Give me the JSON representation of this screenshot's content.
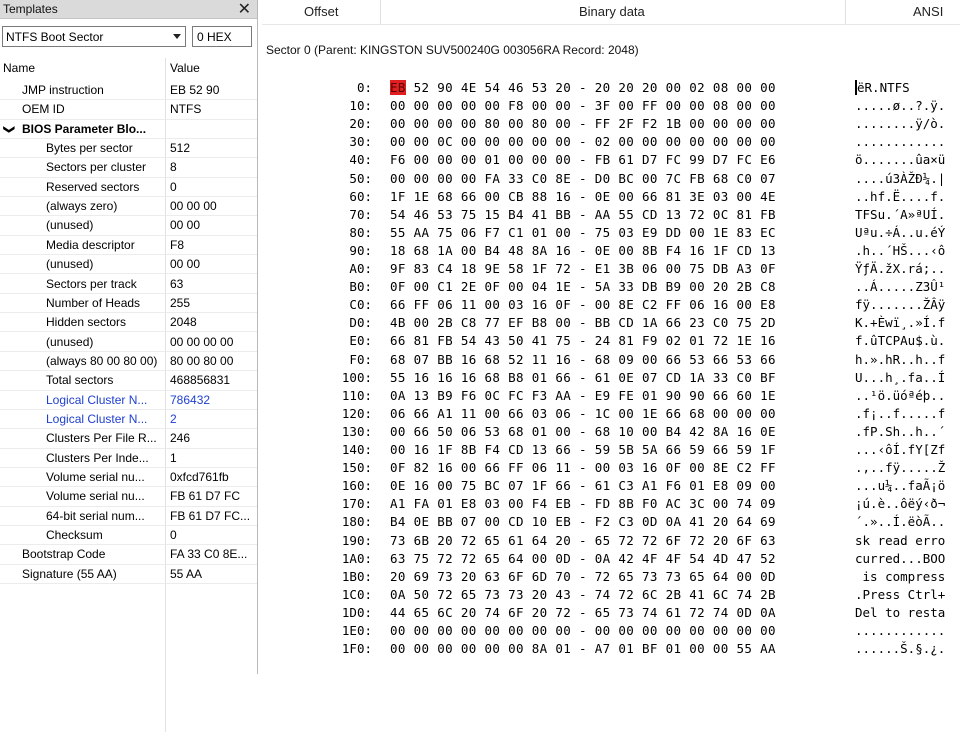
{
  "templates": {
    "title": "Templates",
    "template_select": "NTFS Boot Sector",
    "offset_field": "0 HEX",
    "columns": [
      "Name",
      "Value"
    ],
    "rows": [
      {
        "name": "JMP instruction",
        "value": "EB 52 90",
        "indent": 1
      },
      {
        "name": "OEM ID",
        "value": "NTFS",
        "indent": 1
      },
      {
        "name": "BIOS Parameter Blo...",
        "value": "",
        "indent": 0,
        "group": true
      },
      {
        "name": "Bytes per sector",
        "value": "512",
        "indent": 2
      },
      {
        "name": "Sectors per cluster",
        "value": "8",
        "indent": 2
      },
      {
        "name": "Reserved sectors",
        "value": "0",
        "indent": 2
      },
      {
        "name": "(always zero)",
        "value": "00 00 00",
        "indent": 2
      },
      {
        "name": "(unused)",
        "value": "00 00",
        "indent": 2
      },
      {
        "name": "Media descriptor",
        "value": "F8",
        "indent": 2
      },
      {
        "name": "(unused)",
        "value": "00 00",
        "indent": 2
      },
      {
        "name": "Sectors per track",
        "value": "63",
        "indent": 2
      },
      {
        "name": "Number of Heads",
        "value": "255",
        "indent": 2
      },
      {
        "name": "Hidden sectors",
        "value": "2048",
        "indent": 2
      },
      {
        "name": "(unused)",
        "value": "00 00 00 00",
        "indent": 2
      },
      {
        "name": "(always 80 00 80 00)",
        "value": "80 00 80 00",
        "indent": 2
      },
      {
        "name": "Total sectors",
        "value": "468856831",
        "indent": 2
      },
      {
        "name": "Logical Cluster N...",
        "value": "786432",
        "indent": 2,
        "link": true
      },
      {
        "name": "Logical Cluster N...",
        "value": "2",
        "indent": 2,
        "link": true
      },
      {
        "name": "Clusters Per File R...",
        "value": "246",
        "indent": 2
      },
      {
        "name": "Clusters Per Inde...",
        "value": "1",
        "indent": 2
      },
      {
        "name": "Volume serial nu...",
        "value": "0xfcd761fb",
        "indent": 2
      },
      {
        "name": "Volume serial nu...",
        "value": "FB 61 D7 FC",
        "indent": 2
      },
      {
        "name": "64-bit serial num...",
        "value": "FB 61 D7 FC...",
        "indent": 2
      },
      {
        "name": "Checksum",
        "value": "0",
        "indent": 2
      },
      {
        "name": "Bootstrap Code",
        "value": "FA 33 C0 8E...",
        "indent": 1
      },
      {
        "name": "Signature (55 AA)",
        "value": "55 AA",
        "indent": 1
      }
    ]
  },
  "hexview": {
    "headers": {
      "offset": "Offset",
      "binary": "Binary data",
      "ansi": "ANSI"
    },
    "sector_info": "Sector 0 (Parent: KINGSTON SUV500240G 003056RA Record: 2048)",
    "rows": [
      {
        "off": "0:",
        "hex": "EB 52 90 4E 54 46 53 20 - 20 20 20 00 02 08 00 00",
        "ansi": "ëR.NTFS"
      },
      {
        "off": "10:",
        "hex": "00 00 00 00 00 F8 00 00 - 3F 00 FF 00 00 08 00 00",
        "ansi": ".....ø..?.ÿ."
      },
      {
        "off": "20:",
        "hex": "00 00 00 00 80 00 80 00 - FF 2F F2 1B 00 00 00 00",
        "ansi": "........ÿ/ò."
      },
      {
        "off": "30:",
        "hex": "00 00 0C 00 00 00 00 00 - 02 00 00 00 00 00 00 00",
        "ansi": "............"
      },
      {
        "off": "40:",
        "hex": "F6 00 00 00 01 00 00 00 - FB 61 D7 FC 99 D7 FC E6",
        "ansi": "ö.......ûa×ü"
      },
      {
        "off": "50:",
        "hex": "00 00 00 00 FA 33 C0 8E - D0 BC 00 7C FB 68 C0 07",
        "ansi": "....ú3ÀŽÐ¼.|"
      },
      {
        "off": "60:",
        "hex": "1F 1E 68 66 00 CB 88 16 - 0E 00 66 81 3E 03 00 4E",
        "ansi": "..hf.Ë....f."
      },
      {
        "off": "70:",
        "hex": "54 46 53 75 15 B4 41 BB - AA 55 CD 13 72 0C 81 FB",
        "ansi": "TFSu.´A»ªUÍ."
      },
      {
        "off": "80:",
        "hex": "55 AA 75 06 F7 C1 01 00 - 75 03 E9 DD 00 1E 83 EC",
        "ansi": "Uªu.÷Á..u.éÝ"
      },
      {
        "off": "90:",
        "hex": "18 68 1A 00 B4 48 8A 16 - 0E 00 8B F4 16 1F CD 13",
        "ansi": ".h..´HŠ...‹ô"
      },
      {
        "off": "A0:",
        "hex": "9F 83 C4 18 9E 58 1F 72 - E1 3B 06 00 75 DB A3 0F",
        "ansi": "ŸƒÄ.žX.rá;.."
      },
      {
        "off": "B0:",
        "hex": "0F 00 C1 2E 0F 00 04 1E - 5A 33 DB B9 00 20 2B C8",
        "ansi": "..Á.....Z3Û¹"
      },
      {
        "off": "C0:",
        "hex": "66 FF 06 11 00 03 16 0F - 00 8E C2 FF 06 16 00 E8",
        "ansi": "fÿ.......ŽÂÿ"
      },
      {
        "off": "D0:",
        "hex": "4B 00 2B C8 77 EF B8 00 - BB CD 1A 66 23 C0 75 2D",
        "ansi": "K.+Èwï¸.»Í.f"
      },
      {
        "off": "E0:",
        "hex": "66 81 FB 54 43 50 41 75 - 24 81 F9 02 01 72 1E 16",
        "ansi": "f.ûTCPAu$.ù."
      },
      {
        "off": "F0:",
        "hex": "68 07 BB 16 68 52 11 16 - 68 09 00 66 53 66 53 66",
        "ansi": "h.».hR..h..f"
      },
      {
        "off": "100:",
        "hex": "55 16 16 16 68 B8 01 66 - 61 0E 07 CD 1A 33 C0 BF",
        "ansi": "U...h¸.fa..Í"
      },
      {
        "off": "110:",
        "hex": "0A 13 B9 F6 0C FC F3 AA - E9 FE 01 90 90 66 60 1E",
        "ansi": "..¹ö.üóªéþ.."
      },
      {
        "off": "120:",
        "hex": "06 66 A1 11 00 66 03 06 - 1C 00 1E 66 68 00 00 00",
        "ansi": ".f¡..f.....f"
      },
      {
        "off": "130:",
        "hex": "00 66 50 06 53 68 01 00 - 68 10 00 B4 42 8A 16 0E",
        "ansi": ".fP.Sh..h..´"
      },
      {
        "off": "140:",
        "hex": "00 16 1F 8B F4 CD 13 66 - 59 5B 5A 66 59 66 59 1F",
        "ansi": "...‹ôÍ.fY[Zf"
      },
      {
        "off": "150:",
        "hex": "0F 82 16 00 66 FF 06 11 - 00 03 16 0F 00 8E C2 FF",
        "ansi": ".‚..fÿ.....Ž"
      },
      {
        "off": "160:",
        "hex": "0E 16 00 75 BC 07 1F 66 - 61 C3 A1 F6 01 E8 09 00",
        "ansi": "...u¼..faÃ¡ö"
      },
      {
        "off": "170:",
        "hex": "A1 FA 01 E8 03 00 F4 EB - FD 8B F0 AC 3C 00 74 09",
        "ansi": "¡ú.è..ôëý‹ð¬"
      },
      {
        "off": "180:",
        "hex": "B4 0E BB 07 00 CD 10 EB - F2 C3 0D 0A 41 20 64 69",
        "ansi": "´.»..Í.ëòÃ.."
      },
      {
        "off": "190:",
        "hex": "73 6B 20 72 65 61 64 20 - 65 72 72 6F 72 20 6F 63",
        "ansi": "sk read erro"
      },
      {
        "off": "1A0:",
        "hex": "63 75 72 72 65 64 00 0D - 0A 42 4F 4F 54 4D 47 52",
        "ansi": "curred...BOO"
      },
      {
        "off": "1B0:",
        "hex": "20 69 73 20 63 6F 6D 70 - 72 65 73 73 65 64 00 0D",
        "ansi": " is compress"
      },
      {
        "off": "1C0:",
        "hex": "0A 50 72 65 73 73 20 43 - 74 72 6C 2B 41 6C 74 2B",
        "ansi": ".Press Ctrl+"
      },
      {
        "off": "1D0:",
        "hex": "44 65 6C 20 74 6F 20 72 - 65 73 74 61 72 74 0D 0A",
        "ansi": "Del to resta"
      },
      {
        "off": "1E0:",
        "hex": "00 00 00 00 00 00 00 00 - 00 00 00 00 00 00 00 00",
        "ansi": "............"
      },
      {
        "off": "1F0:",
        "hex": "00 00 00 00 00 00 8A 01 - A7 01 BF 01 00 00 55 AA",
        "ansi": "......Š.§.¿."
      }
    ]
  },
  "colors": {
    "selected_byte": "#e02020",
    "link": "#1f3fd0"
  }
}
